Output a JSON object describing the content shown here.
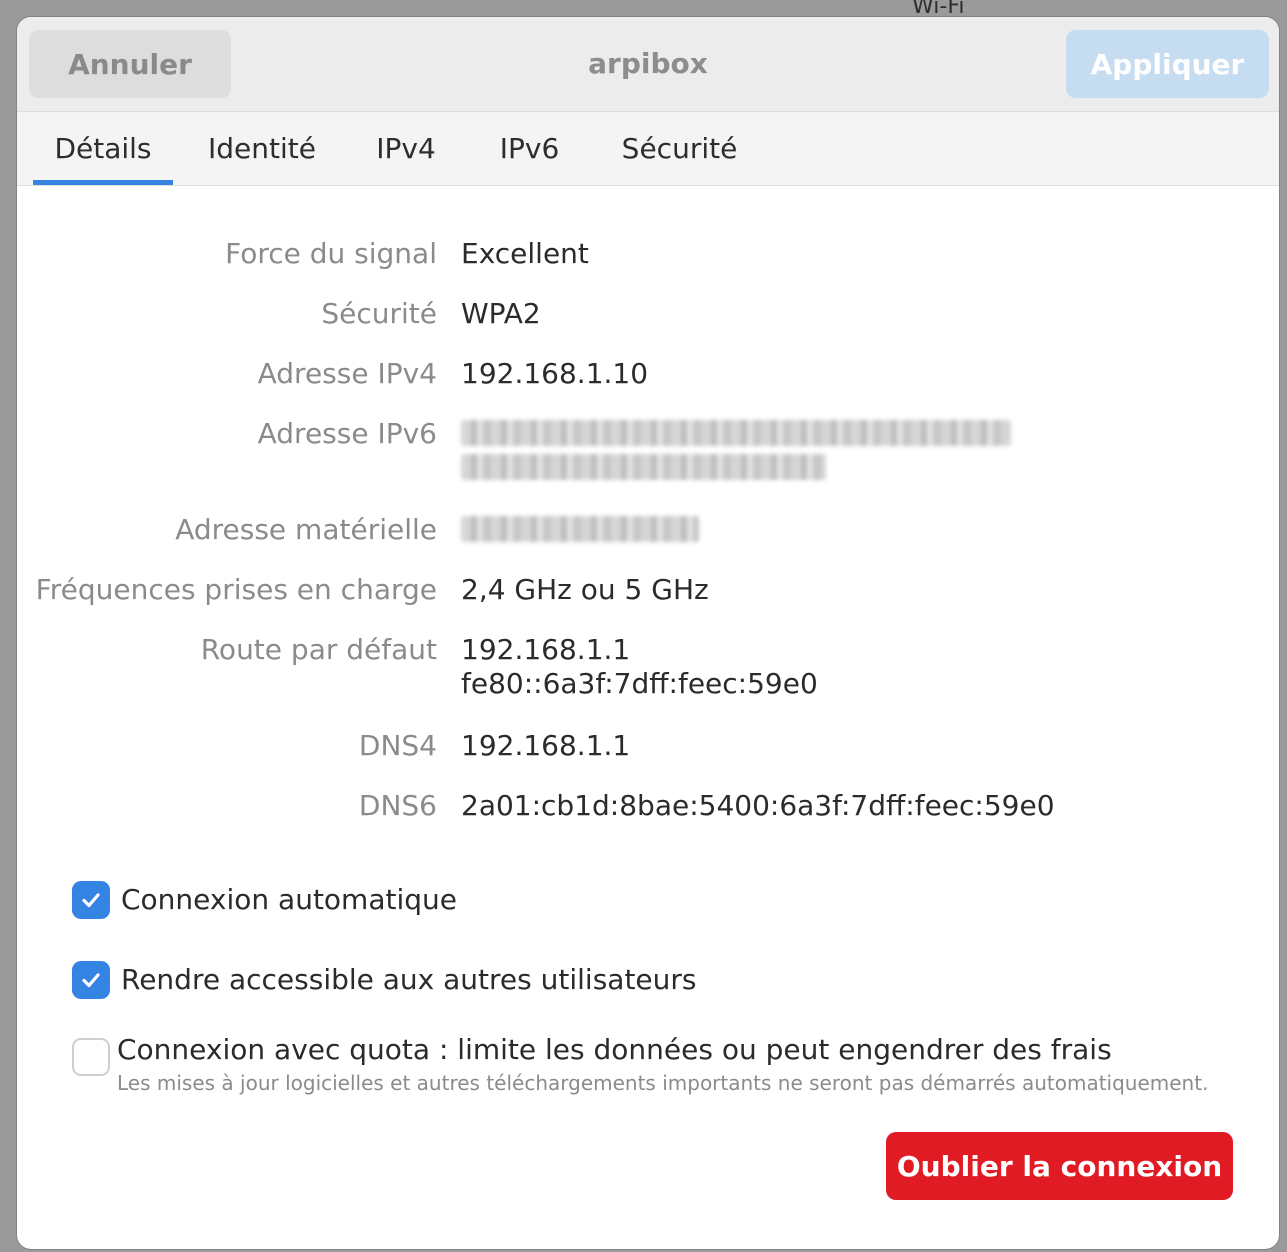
{
  "background": {
    "window_title": "Wi-Fi"
  },
  "header": {
    "cancel_label": "Annuler",
    "title": "arpibox",
    "apply_label": "Appliquer"
  },
  "tabs": [
    {
      "label": "Détails",
      "active": true
    },
    {
      "label": "Identité"
    },
    {
      "label": "IPv4"
    },
    {
      "label": "IPv6"
    },
    {
      "label": "Sécurité"
    }
  ],
  "details": {
    "signal_label": "Force du signal",
    "signal_value": "Excellent",
    "security_label": "Sécurité",
    "security_value": "WPA2",
    "ipv4_label": "Adresse IPv4",
    "ipv4_value": "192.168.1.10",
    "ipv6_label": "Adresse IPv6",
    "hw_label": "Adresse matérielle",
    "freq_label": "Fréquences prises en charge",
    "freq_value": "2,4 GHz ou 5 GHz",
    "route_label": "Route par défaut",
    "route_value_1": "192.168.1.1",
    "route_value_2": "fe80::6a3f:7dff:feec:59e0",
    "dns4_label": "DNS4",
    "dns4_value": "192.168.1.1",
    "dns6_label": "DNS6",
    "dns6_value": "2a01:cb1d:8bae:5400:6a3f:7dff:feec:59e0"
  },
  "options": {
    "auto_connect_label": "Connexion automatique",
    "auto_connect_checked": true,
    "shared_label": "Rendre accessible aux autres utilisateurs",
    "shared_checked": true,
    "metered_label": "Connexion avec quota : limite les données ou peut engendrer des frais",
    "metered_sub": "Les mises à jour logicielles et autres téléchargements importants ne seront pas démarrés automatiquement.",
    "metered_checked": false
  },
  "forget_label": "Oublier la connexion",
  "colors": {
    "accent": "#3584e4",
    "destructive": "#e01b24"
  }
}
